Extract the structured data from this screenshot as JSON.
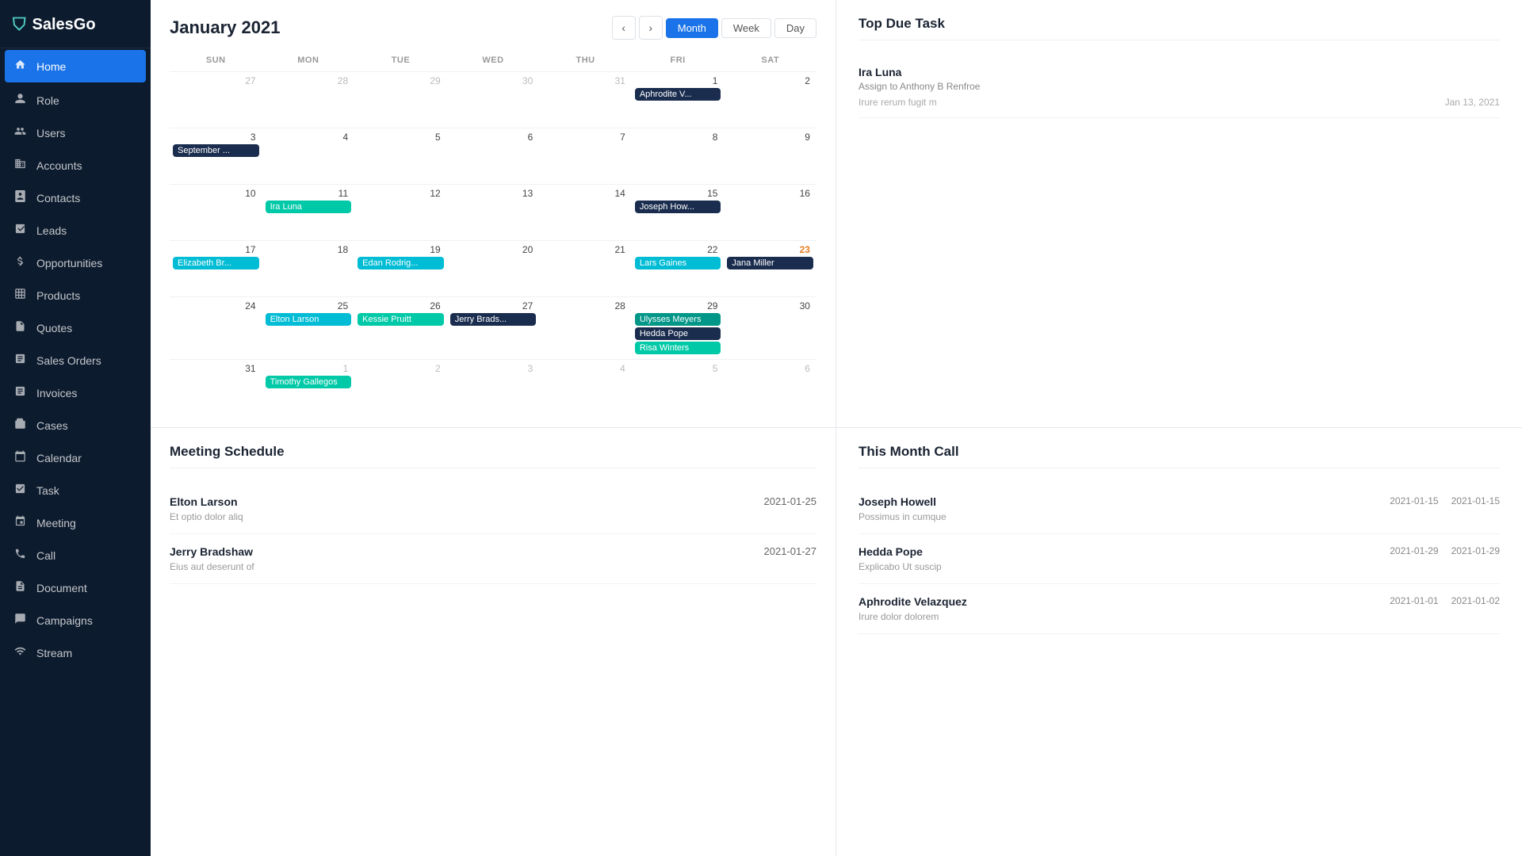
{
  "app": {
    "name": "SalesGo"
  },
  "sidebar": {
    "items": [
      {
        "id": "home",
        "label": "Home",
        "icon": "🏠",
        "active": true
      },
      {
        "id": "role",
        "label": "Role",
        "icon": "👤"
      },
      {
        "id": "users",
        "label": "Users",
        "icon": "👥"
      },
      {
        "id": "accounts",
        "label": "Accounts",
        "icon": "🏢"
      },
      {
        "id": "contacts",
        "label": "Contacts",
        "icon": "📋"
      },
      {
        "id": "leads",
        "label": "Leads",
        "icon": "📌"
      },
      {
        "id": "opportunities",
        "label": "Opportunities",
        "icon": "💰"
      },
      {
        "id": "products",
        "label": "Products",
        "icon": "📦"
      },
      {
        "id": "quotes",
        "label": "Quotes",
        "icon": "📄"
      },
      {
        "id": "sales-orders",
        "label": "Sales Orders",
        "icon": "🧾"
      },
      {
        "id": "invoices",
        "label": "Invoices",
        "icon": "📑"
      },
      {
        "id": "cases",
        "label": "Cases",
        "icon": "💼"
      },
      {
        "id": "calendar",
        "label": "Calendar",
        "icon": "📅"
      },
      {
        "id": "task",
        "label": "Task",
        "icon": "✅"
      },
      {
        "id": "meeting",
        "label": "Meeting",
        "icon": "📆"
      },
      {
        "id": "call",
        "label": "Call",
        "icon": "📞"
      },
      {
        "id": "document",
        "label": "Document",
        "icon": "📝"
      },
      {
        "id": "campaigns",
        "label": "Campaigns",
        "icon": "📣"
      },
      {
        "id": "stream",
        "label": "Stream",
        "icon": "📡"
      }
    ]
  },
  "calendar": {
    "title": "January 2021",
    "view_buttons": [
      "Month",
      "Week",
      "Day"
    ],
    "active_view": "Month",
    "day_names": [
      "SUN",
      "MON",
      "TUE",
      "WED",
      "THU",
      "FRI",
      "SAT"
    ],
    "weeks": [
      {
        "days": [
          {
            "date": "27",
            "other": true,
            "events": []
          },
          {
            "date": "28",
            "other": true,
            "events": []
          },
          {
            "date": "29",
            "other": true,
            "events": []
          },
          {
            "date": "30",
            "other": true,
            "events": []
          },
          {
            "date": "31",
            "other": true,
            "events": []
          },
          {
            "date": "1",
            "events": [
              {
                "label": "Aphrodite V...",
                "color": "event-dark-blue"
              }
            ]
          },
          {
            "date": "2",
            "events": []
          }
        ]
      },
      {
        "days": [
          {
            "date": "3",
            "events": [
              {
                "label": "September ...",
                "color": "event-dark-blue"
              }
            ]
          },
          {
            "date": "4",
            "events": []
          },
          {
            "date": "5",
            "events": []
          },
          {
            "date": "6",
            "events": []
          },
          {
            "date": "7",
            "events": []
          },
          {
            "date": "8",
            "events": []
          },
          {
            "date": "9",
            "events": []
          }
        ]
      },
      {
        "days": [
          {
            "date": "10",
            "events": []
          },
          {
            "date": "11",
            "events": [
              {
                "label": "Ira Luna",
                "color": "event-green",
                "span": 3
              }
            ]
          },
          {
            "date": "12",
            "events": []
          },
          {
            "date": "13",
            "events": []
          },
          {
            "date": "14",
            "events": []
          },
          {
            "date": "15",
            "events": [
              {
                "label": "Joseph How...",
                "color": "event-dark-blue"
              }
            ]
          },
          {
            "date": "16",
            "events": []
          }
        ]
      },
      {
        "days": [
          {
            "date": "17",
            "events": [
              {
                "label": "Elizabeth Br...",
                "color": "event-teal"
              }
            ]
          },
          {
            "date": "18",
            "events": []
          },
          {
            "date": "19",
            "events": [
              {
                "label": "Edan Rodrig...",
                "color": "event-teal"
              }
            ]
          },
          {
            "date": "20",
            "events": []
          },
          {
            "date": "21",
            "events": []
          },
          {
            "date": "22",
            "events": [
              {
                "label": "Lars Gaines",
                "color": "event-teal"
              }
            ]
          },
          {
            "date": "23",
            "today": true,
            "events": [
              {
                "label": "Jana Miller",
                "color": "event-dark-blue"
              }
            ]
          }
        ]
      },
      {
        "days": [
          {
            "date": "24",
            "events": []
          },
          {
            "date": "25",
            "events": [
              {
                "label": "Elton Larson",
                "color": "event-teal"
              }
            ]
          },
          {
            "date": "26",
            "events": [
              {
                "label": "Kessie Pruitt",
                "color": "event-green",
                "span": 2
              }
            ]
          },
          {
            "date": "27",
            "events": [
              {
                "label": "Jerry Brads...",
                "color": "event-dark-blue"
              }
            ]
          },
          {
            "date": "28",
            "events": []
          },
          {
            "date": "29",
            "events": [
              {
                "label": "Ulysses Meyers",
                "color": "event-dark-teal"
              },
              {
                "label": "Hedda Pope",
                "color": "event-dark-blue"
              },
              {
                "label": "Risa Winters",
                "color": "event-green"
              }
            ]
          },
          {
            "date": "30",
            "events": []
          }
        ]
      },
      {
        "days": [
          {
            "date": "31",
            "events": []
          },
          {
            "date": "1",
            "other": true,
            "events": [
              {
                "label": "Timothy Gallegos",
                "color": "event-green",
                "span": 2
              }
            ]
          },
          {
            "date": "2",
            "other": true,
            "events": []
          },
          {
            "date": "3",
            "other": true,
            "events": []
          },
          {
            "date": "4",
            "other": true,
            "events": []
          },
          {
            "date": "5",
            "other": true,
            "events": []
          },
          {
            "date": "6",
            "other": true,
            "events": []
          }
        ]
      }
    ]
  },
  "top_due_task": {
    "title": "Top Due Task",
    "tasks": [
      {
        "name": "Ira Luna",
        "assign": "Assign to Anthony B Renfroe",
        "description": "Irure rerum fugit m",
        "date": "Jan 13, 2021"
      }
    ]
  },
  "meeting_schedule": {
    "title": "Meeting Schedule",
    "meetings": [
      {
        "name": "Elton Larson",
        "description": "Et optio dolor aliq",
        "date": "2021-01-25"
      },
      {
        "name": "Jerry Bradshaw",
        "description": "Eius aut deserunt of",
        "date": "2021-01-27"
      }
    ]
  },
  "this_month_call": {
    "title": "This Month Call",
    "calls": [
      {
        "name": "Joseph Howell",
        "description": "Possimus in cumque",
        "date1": "2021-01-15",
        "date2": "2021-01-15"
      },
      {
        "name": "Hedda Pope",
        "description": "Explicabo Ut suscip",
        "date1": "2021-01-29",
        "date2": "2021-01-29"
      },
      {
        "name": "Aphrodite Velazquez",
        "description": "Irure dolor dolorem",
        "date1": "2021-01-01",
        "date2": "2021-01-02"
      }
    ]
  }
}
